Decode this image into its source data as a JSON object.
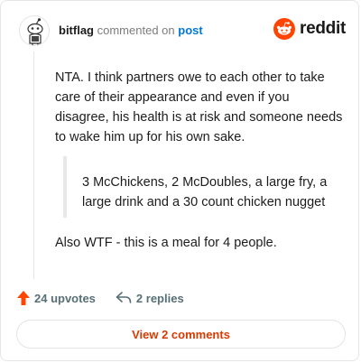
{
  "comment": {
    "username": "bitflag",
    "action_text": "commented on",
    "post_link": "post",
    "paragraphs": [
      "NTA. I think partners owe to each other to take care of their appearance and even if you disagree, his health is at risk and someone needs to wake him up for his own sake."
    ],
    "quote": "3 McChickens, 2 McDoubles, a large fry, a large drink and a 30 count chicken nugget",
    "tail": "Also WTF - this is a meal for 4 people."
  },
  "brand": {
    "wordmark": "reddit",
    "color": "#ff4500"
  },
  "footer": {
    "upvotes": "24 upvotes",
    "replies": "2 replies",
    "view_button": "View 2 comments"
  },
  "colors": {
    "accent": "#d93a00",
    "upvote": "#ff4500",
    "link": "#0079d3"
  },
  "icons": {
    "avatar": "snoo-avatar",
    "logo": "reddit-snoo-icon",
    "upvote": "upvote-arrow-icon",
    "reply": "reply-arrow-icon"
  }
}
